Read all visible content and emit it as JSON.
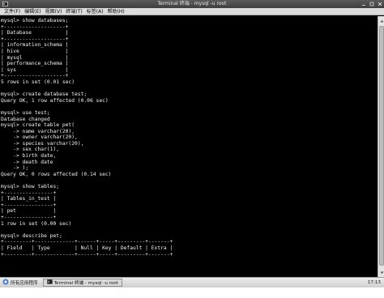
{
  "window": {
    "title": "Terminal 终端 - mysql -u root"
  },
  "menu": [
    "文件(F)",
    "编辑(E)",
    "视图(V)",
    "终端(T)",
    "标签(A)",
    "帮助(H)"
  ],
  "terminal_lines": [
    "mysql> show databases;",
    "+--------------------+",
    "| Database           |",
    "+--------------------+",
    "| information_schema |",
    "| hive               |",
    "| mysql              |",
    "| performance_schema |",
    "| sys                |",
    "+--------------------+",
    "5 rows in set (0.01 sec)",
    "",
    "mysql> create database test;",
    "Query OK, 1 row affected (0.06 sec)",
    "",
    "mysql> use test;",
    "Database changed",
    "mysql> create table pet(",
    "    -> name varchar(20),",
    "    -> owner varchar(20),",
    "    -> species varchar(20),",
    "    -> sex char(1),",
    "    -> birth date,",
    "    -> death date",
    "    -> );",
    "Query OK, 0 rows affected (0.14 sec)",
    "",
    "mysql> show tables;",
    "+----------------+",
    "| Tables_in_test |",
    "+----------------+",
    "| pet            |",
    "+----------------+",
    "1 row in set (0.00 sec)",
    "",
    "mysql> describe pet;",
    "+---------+-------------+------+-----+---------+-------+",
    "| Field   | Type        | Null | Key | Default | Extra |",
    "+---------+-------------+------+-----+---------+-------+"
  ],
  "taskbar": {
    "start_label": "所有应用程序",
    "task_label": "Terminal 终端 - mysql -u root",
    "clock": "17:13"
  }
}
